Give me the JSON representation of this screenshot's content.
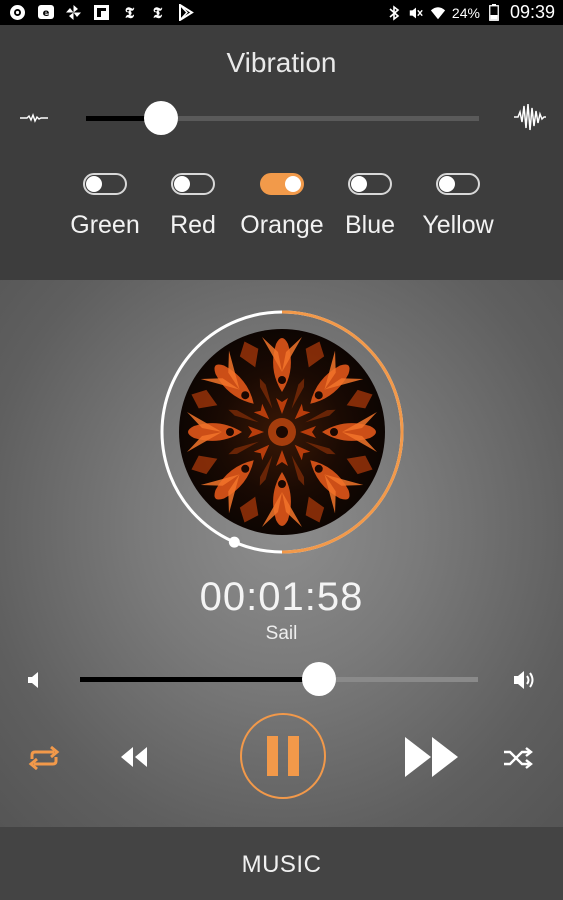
{
  "status_bar": {
    "left_icons": [
      "camera-icon",
      "chat-icon",
      "pinwheel-icon",
      "flipboard-icon",
      "nyt-icon",
      "nyt-icon",
      "play-store-icon"
    ],
    "right_icons": [
      "bluetooth-icon",
      "mute-icon",
      "wifi-icon",
      "battery-icon"
    ],
    "battery": "24%",
    "time": "09:39"
  },
  "vibration": {
    "title": "Vibration",
    "level": 0.19
  },
  "colors": [
    {
      "label": "Green",
      "on": false
    },
    {
      "label": "Red",
      "on": false
    },
    {
      "label": "Orange",
      "on": true
    },
    {
      "label": "Blue",
      "on": false
    },
    {
      "label": "Yellow",
      "on": false
    }
  ],
  "player": {
    "elapsed": "00:01:58",
    "track": "Sail",
    "progress": 0.5,
    "volume": 0.6
  },
  "controls": {
    "repeat": "repeat-icon",
    "rewind": "rewind-icon",
    "pause": "pause-icon",
    "fast_forward": "fast-forward-icon",
    "shuffle": "shuffle-icon"
  },
  "bottom_nav": {
    "label": "MUSIC"
  },
  "accent": "#f2994a"
}
